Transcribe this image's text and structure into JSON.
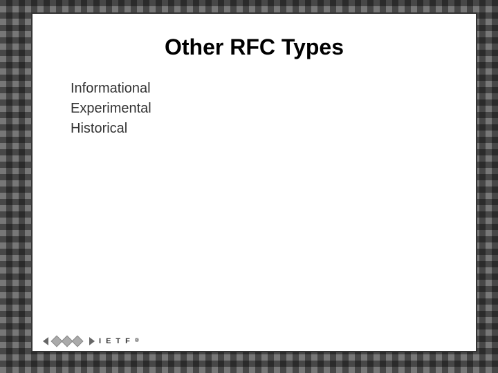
{
  "slide": {
    "title": "Other RFC Types",
    "bullets": [
      {
        "text": "Informational"
      },
      {
        "text": "Experimental"
      },
      {
        "text": "Historical"
      }
    ]
  },
  "footer": {
    "logo_letters": [
      "I",
      "E",
      "T",
      "F"
    ],
    "trademark": "®"
  }
}
